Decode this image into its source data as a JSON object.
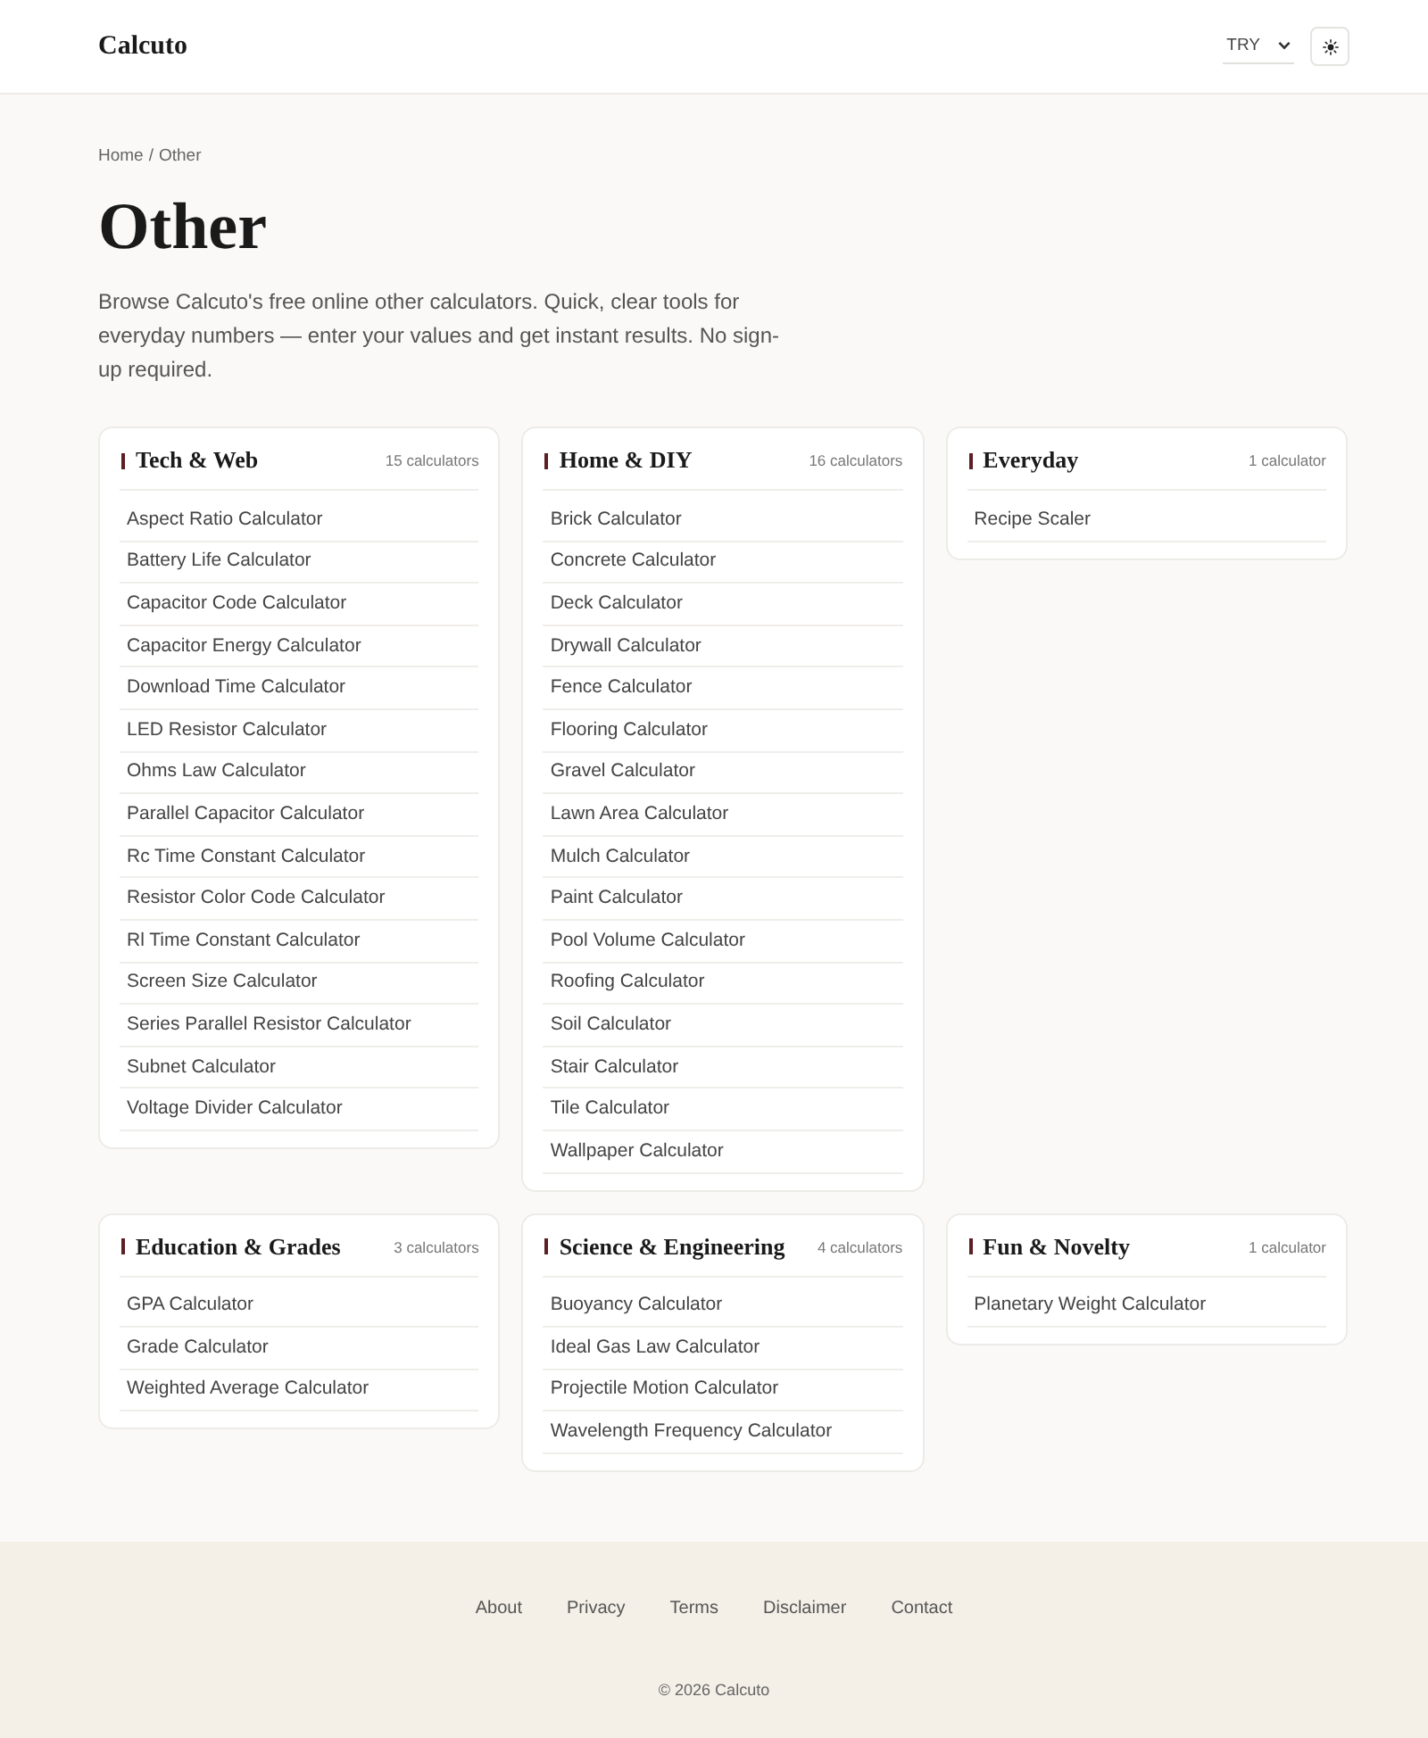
{
  "header": {
    "logo": "Calcuto",
    "currency": {
      "value": "TRY"
    }
  },
  "breadcrumb": {
    "items": [
      "Home",
      "Other"
    ],
    "separator": "/"
  },
  "page": {
    "title": "Other",
    "description": "Browse Calcuto's free online other calculators. Quick, clear tools for everyday numbers — enter your values and get instant results. No sign-up required."
  },
  "categories": [
    {
      "title": "Tech & Web",
      "count": "15 calculators",
      "items": [
        "Aspect Ratio Calculator",
        "Battery Life Calculator",
        "Capacitor Code Calculator",
        "Capacitor Energy Calculator",
        "Download Time Calculator",
        "LED Resistor Calculator",
        "Ohms Law Calculator",
        "Parallel Capacitor Calculator",
        "Rc Time Constant Calculator",
        "Resistor Color Code Calculator",
        "Rl Time Constant Calculator",
        "Screen Size Calculator",
        "Series Parallel Resistor Calculator",
        "Subnet Calculator",
        "Voltage Divider Calculator"
      ]
    },
    {
      "title": "Home & DIY",
      "count": "16 calculators",
      "items": [
        "Brick Calculator",
        "Concrete Calculator",
        "Deck Calculator",
        "Drywall Calculator",
        "Fence Calculator",
        "Flooring Calculator",
        "Gravel Calculator",
        "Lawn Area Calculator",
        "Mulch Calculator",
        "Paint Calculator",
        "Pool Volume Calculator",
        "Roofing Calculator",
        "Soil Calculator",
        "Stair Calculator",
        "Tile Calculator",
        "Wallpaper Calculator"
      ]
    },
    {
      "title": "Everyday",
      "count": "1 calculator",
      "items": [
        "Recipe Scaler"
      ]
    },
    {
      "title": "Education & Grades",
      "count": "3 calculators",
      "items": [
        "GPA Calculator",
        "Grade Calculator",
        "Weighted Average Calculator"
      ]
    },
    {
      "title": "Science & Engineering",
      "count": "4 calculators",
      "items": [
        "Buoyancy Calculator",
        "Ideal Gas Law Calculator",
        "Projectile Motion Calculator",
        "Wavelength Frequency Calculator"
      ]
    },
    {
      "title": "Fun & Novelty",
      "count": "1 calculator",
      "items": [
        "Planetary Weight Calculator"
      ]
    }
  ],
  "footer": {
    "links": [
      "About",
      "Privacy",
      "Terms",
      "Disclaimer",
      "Contact"
    ],
    "copyright": "© 2026 Calcuto"
  }
}
